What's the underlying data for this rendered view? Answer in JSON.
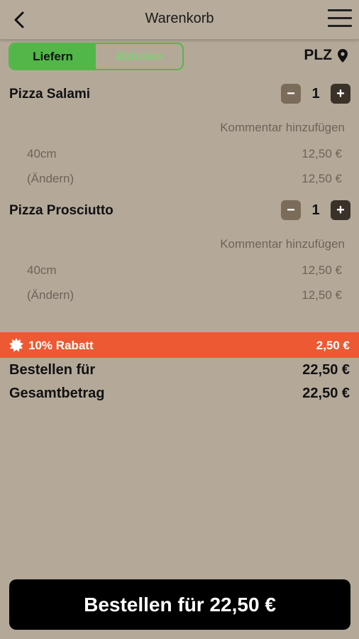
{
  "header": {
    "title": "Warenkorb"
  },
  "delivery_toggle": {
    "active": "Liefern",
    "inactive": "Abholen"
  },
  "plz_label": "PLZ",
  "items": [
    {
      "name": "Pizza Salami",
      "qty": "1",
      "comment": "Kommentar hinzufügen",
      "size": "40cm",
      "size_price": "12,50 €",
      "change": "(Ändern)",
      "change_price": "12,50 €"
    },
    {
      "name": "Pizza Prosciutto",
      "qty": "1",
      "comment": "Kommentar hinzufügen",
      "size": "40cm",
      "size_price": "12,50 €",
      "change": "(Ändern)",
      "change_price": "12,50 €"
    }
  ],
  "discount": {
    "label": "10% Rabatt",
    "amount": "2,50 €"
  },
  "totals": {
    "order_label": "Bestellen für",
    "order_value": "22,50 €",
    "total_label": "Gesamtbetrag",
    "total_value": "22,50 €"
  },
  "cta_label": "Bestellen für 22,50 €",
  "colors": {
    "accent_green": "#52b748",
    "discount_bg": "#ec5933",
    "background": "#b4a999"
  }
}
